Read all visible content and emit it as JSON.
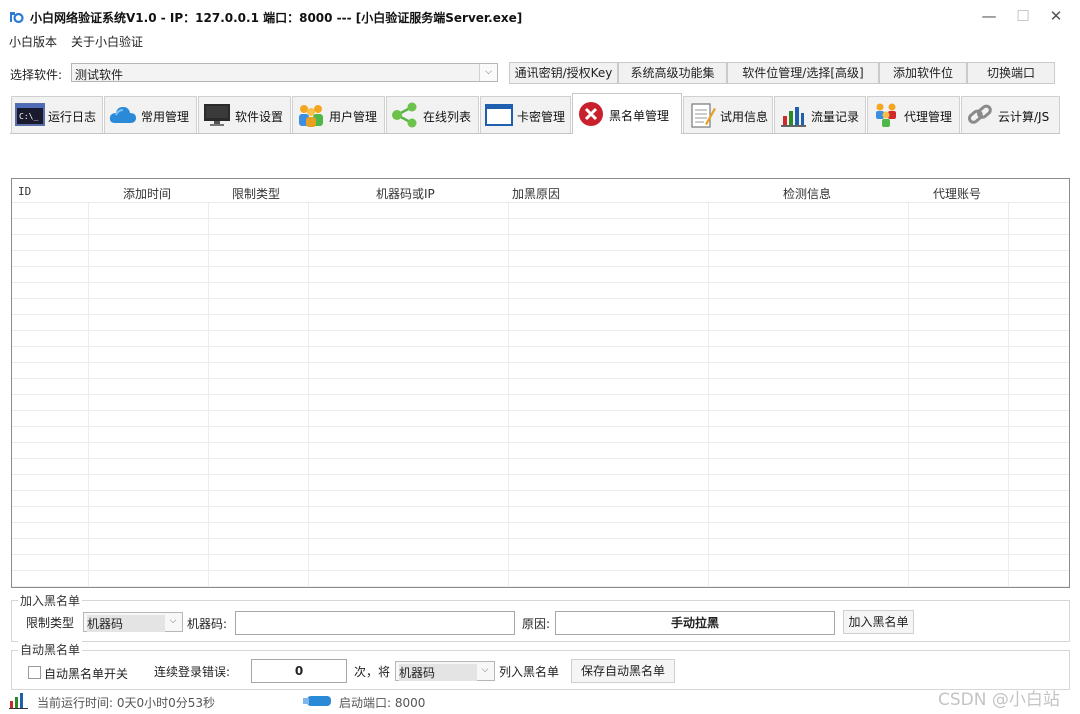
{
  "window": {
    "title": "小白网络验证系统V1.0 - IP：127.0.0.1 端口：8000   ---   [小白验证服务端Server.exe]",
    "controls": [
      "—",
      "☐",
      "✕"
    ]
  },
  "menu": [
    "小白版本",
    "关于小白验证"
  ],
  "software_select": {
    "label": "选择软件:",
    "value": "测试软件"
  },
  "top_buttons": [
    "通讯密钥/授权Key",
    "系统高级功能集",
    "软件位管理/选择[高级]",
    "添加软件位",
    "切换端口"
  ],
  "tabs": [
    {
      "label": "运行日志",
      "icon": "console-icon",
      "active": false
    },
    {
      "label": "常用管理",
      "icon": "cloud-icon",
      "active": false
    },
    {
      "label": "软件设置",
      "icon": "monitor-icon",
      "active": false
    },
    {
      "label": "用户管理",
      "icon": "users-icon",
      "active": false
    },
    {
      "label": "在线列表",
      "icon": "share-icon",
      "active": false
    },
    {
      "label": "卡密管理",
      "icon": "window-icon",
      "active": false
    },
    {
      "label": "黑名单管理",
      "icon": "blacklist-x-icon",
      "active": true
    },
    {
      "label": "试用信息",
      "icon": "notepad-icon",
      "active": false
    },
    {
      "label": "流量记录",
      "icon": "bar-chart-icon",
      "active": false
    },
    {
      "label": "代理管理",
      "icon": "agents-icon",
      "active": false
    },
    {
      "label": "云计算/JS",
      "icon": "link-icon",
      "active": false
    }
  ],
  "table": {
    "columns": [
      "ID",
      "添加时间",
      "限制类型",
      "机器码或IP",
      "加黑原因",
      "检测信息",
      "代理账号"
    ],
    "rows": []
  },
  "add_blacklist": {
    "group_title": "加入黑名单",
    "type_label": "限制类型",
    "type_value": "机器码",
    "machine_label": "机器码:",
    "machine_value": "",
    "reason_label": "原因:",
    "reason_value": "手动拉黑",
    "submit_label": "加入黑名单"
  },
  "auto_blacklist": {
    "group_title": "自动黑名单",
    "switch_label": "自动黑名单开关",
    "switch_checked": false,
    "errors_label": "连续登录错误:",
    "errors_value": "0",
    "times_label": "次，将",
    "type_value": "机器码",
    "into_label": "列入黑名单",
    "save_label": "保存自动黑名单"
  },
  "status": {
    "uptime": "当前运行时间: 0天0小时0分53秒",
    "port": "启动端口: 8000"
  },
  "watermark": "CSDN @小白站"
}
